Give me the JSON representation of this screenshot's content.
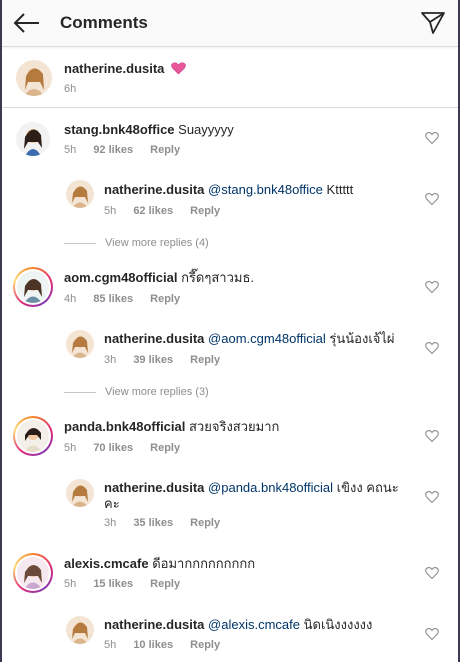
{
  "header": {
    "title": "Comments",
    "back_icon": "arrow-left-icon",
    "send_icon": "paper-plane-icon"
  },
  "caption": {
    "username": "natherine.dusita",
    "emoji": "pink-heart-icon",
    "time": "6h"
  },
  "comments": [
    {
      "username": "stang.bnk48office",
      "text": "Suayyyyy",
      "time": "5h",
      "likes": "92 likes",
      "reply_label": "Reply",
      "reply": {
        "username": "natherine.dusita",
        "mention": "@stang.bnk48office",
        "text": "Kttttt",
        "time": "5h",
        "likes": "62 likes",
        "reply_label": "Reply"
      },
      "view_more": "View more replies (4)"
    },
    {
      "username": "aom.cgm48official",
      "text": "กรี๊ดๆสาวมธ.",
      "time": "4h",
      "likes": "85 likes",
      "reply_label": "Reply",
      "reply": {
        "username": "natherine.dusita",
        "mention": "@aom.cgm48official",
        "text": "รุ่นน้องเจ้ไผ่",
        "time": "3h",
        "likes": "39 likes",
        "reply_label": "Reply"
      },
      "view_more": "View more replies (3)"
    },
    {
      "username": "panda.bnk48official",
      "text": "สวยจริงสวยมาก",
      "time": "5h",
      "likes": "70 likes",
      "reply_label": "Reply",
      "reply": {
        "username": "natherine.dusita",
        "mention": "@panda.bnk48official",
        "text": "เขิงง คถนะ",
        "text_line2": "คะ",
        "time": "3h",
        "likes": "35 likes",
        "reply_label": "Reply"
      }
    },
    {
      "username": "alexis.cmcafe",
      "text": "ดีอมากกกกกกกกก",
      "time": "5h",
      "likes": "15 likes",
      "reply_label": "Reply",
      "reply": {
        "username": "natherine.dusita",
        "mention": "@alexis.cmcafe",
        "text": "นิดเนิงงงงงง",
        "time": "5h",
        "likes": "10 likes",
        "reply_label": "Reply"
      }
    }
  ],
  "colors": {
    "mention": "#003569",
    "meta": "#8e8e8e",
    "heart_emoji": "#e9579b"
  }
}
